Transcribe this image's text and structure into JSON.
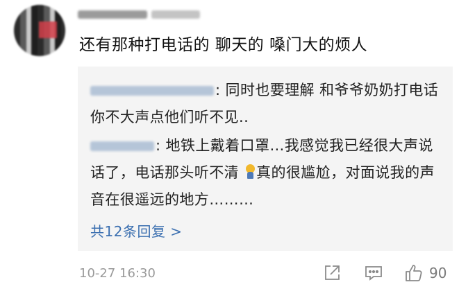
{
  "comment": {
    "text": "还有那种打电话的 聊天的 嗓门大的烦人",
    "time": "10-27 16:30",
    "likes": "90"
  },
  "replies": [
    {
      "text": ": 同时也要理解 和爷爷奶奶打电话 你不大声点他们听不见.."
    },
    {
      "text_a": ": 地铁上戴着口罩…我感觉我已经很大声说话了，电话那头听不清 ",
      "text_b": "真的很尴尬，对面说我的声音在很遥远的地方………"
    }
  ],
  "more_replies": "共12条回复 >",
  "icons": [
    "share-icon",
    "reply-comment-icon",
    "like-thumb-icon",
    "emoji-sweat-icon"
  ],
  "colors": {
    "link": "#3b6fb0",
    "reply_bg": "#f4f4f4",
    "meta": "#9a9a9a"
  }
}
